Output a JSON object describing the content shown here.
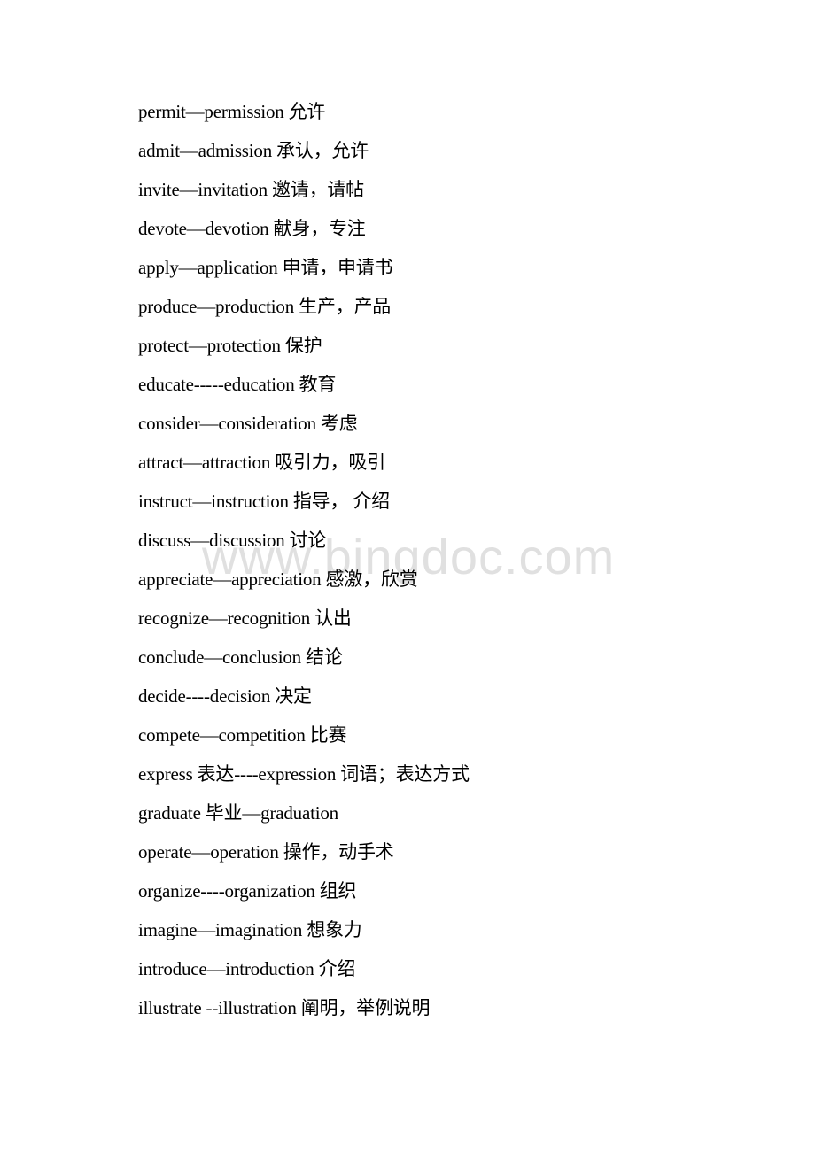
{
  "document": {
    "watermark": "www.bingdoc.com",
    "lines": [
      "permit—permission 允许",
      "admit—admission 承认，允许",
      "invite—invitation 邀请，请帖",
      "devote—devotion 献身，专注",
      "apply—application 申请，申请书",
      "produce—production 生产，产品",
      "protect—protection 保护",
      "educate-----education 教育",
      "consider—consideration 考虑",
      "attract—attraction 吸引力，吸引",
      "instruct—instruction 指导， 介绍",
      "discuss—discussion 讨论",
      "appreciate—appreciation 感激，欣赏",
      "recognize—recognition 认出",
      "conclude—conclusion 结论",
      "decide----decision 决定",
      "compete—competition 比赛",
      "express 表达----expression 词语；表达方式",
      "graduate 毕业—graduation",
      "operate—operation 操作，动手术",
      "organize----organization 组织",
      "imagine—imagination 想象力",
      "introduce—introduction 介绍",
      "illustrate --illustration 阐明，举例说明"
    ]
  }
}
